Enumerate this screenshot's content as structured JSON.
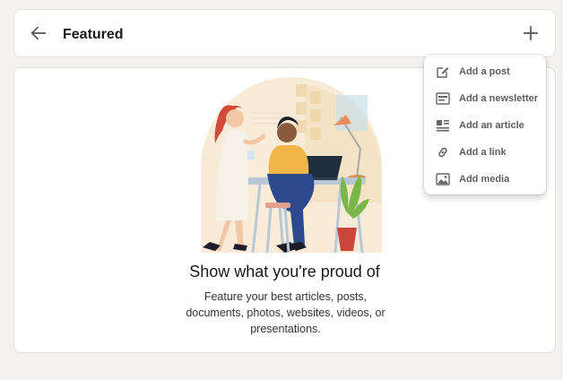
{
  "header": {
    "title": "Featured",
    "back_icon": "arrow-left-icon",
    "add_icon": "plus-icon"
  },
  "empty_state": {
    "title": "Show what you're proud of",
    "description": "Feature your best articles, posts, documents, photos, websites, videos, or presentations."
  },
  "add_menu": {
    "items": [
      {
        "label": "Add a post",
        "icon": "pencil-square-icon"
      },
      {
        "label": "Add a newsletter",
        "icon": "newsletter-icon"
      },
      {
        "label": "Add an article",
        "icon": "article-icon"
      },
      {
        "label": "Add a link",
        "icon": "link-icon"
      },
      {
        "label": "Add media",
        "icon": "image-icon"
      }
    ]
  },
  "colors": {
    "page_background": "#f3f2ef",
    "card_background": "#ffffff",
    "menu_text": "#5e5e5e",
    "icon_gray": "#666666"
  }
}
